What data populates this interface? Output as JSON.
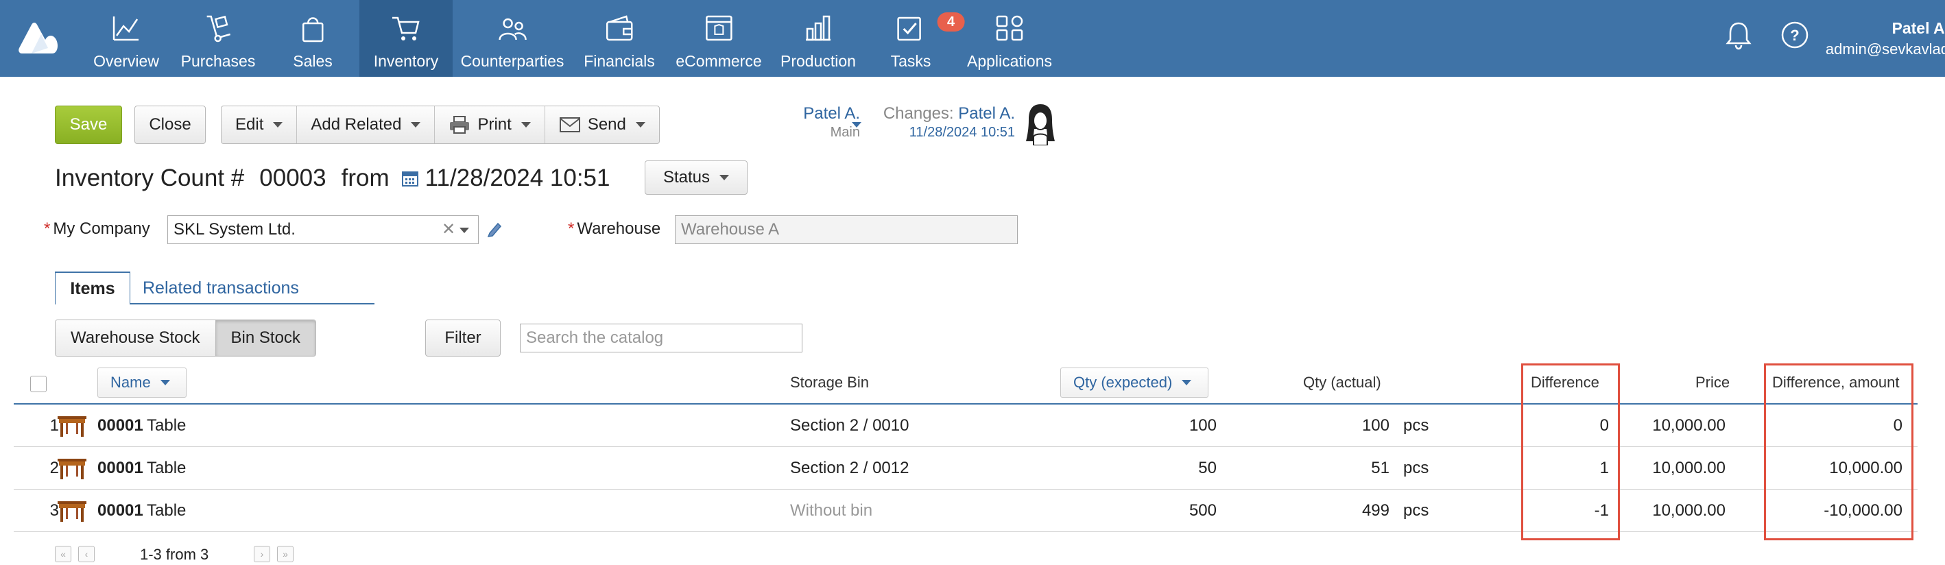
{
  "nav": {
    "items": [
      {
        "label": "Overview",
        "icon": "chart-line-icon",
        "active": false
      },
      {
        "label": "Purchases",
        "icon": "hand-truck-icon",
        "active": false
      },
      {
        "label": "Sales",
        "icon": "shopping-bag-icon",
        "active": false
      },
      {
        "label": "Inventory",
        "icon": "cart-icon",
        "active": true
      },
      {
        "label": "Counterparties",
        "icon": "people-icon",
        "active": false
      },
      {
        "label": "Financials",
        "icon": "wallet-icon",
        "active": false
      },
      {
        "label": "eCommerce",
        "icon": "store-icon",
        "active": false
      },
      {
        "label": "Production",
        "icon": "factory-icon",
        "active": false
      },
      {
        "label": "Tasks",
        "icon": "checkbox-icon",
        "active": false,
        "badge": "4"
      },
      {
        "label": "Applications",
        "icon": "apps-grid-icon",
        "active": false
      }
    ],
    "user_name": "Patel A.",
    "user_email": "admin@sevkavlad"
  },
  "toolbar": {
    "save": "Save",
    "close": "Close",
    "edit": "Edit",
    "add_related": "Add Related",
    "print": "Print",
    "send": "Send"
  },
  "responsible": {
    "name": "Patel A.",
    "sub": "Main"
  },
  "changes": {
    "label": "Changes:",
    "name": "Patel A.",
    "date": "11/28/2024 10:51"
  },
  "document": {
    "title": "Inventory Count #",
    "number": "00003",
    "from": "from",
    "datetime": "11/28/2024 10:51",
    "status": "Status"
  },
  "fields": {
    "company_label": "My Company",
    "company_value": "SKL System Ltd.",
    "warehouse_label": "Warehouse",
    "warehouse_placeholder": "Warehouse A"
  },
  "tabs": {
    "items": "Items",
    "related": "Related transactions"
  },
  "stock_toggle": {
    "warehouse": "Warehouse Stock",
    "bin": "Bin Stock"
  },
  "filter": {
    "button": "Filter",
    "placeholder": "Search the catalog"
  },
  "table": {
    "headers": {
      "name": "Name",
      "storage_bin": "Storage Bin",
      "qty_expected": "Qty (expected)",
      "qty_actual": "Qty (actual)",
      "difference": "Difference",
      "price": "Price",
      "difference_amount": "Difference, amount"
    },
    "rows": [
      {
        "num": "1",
        "code": "00001",
        "name": "Table",
        "bin": "Section 2 / 0010",
        "bin_muted": false,
        "expected": "100",
        "actual": "100",
        "unit": "pcs",
        "difference": "0",
        "price": "10,000.00",
        "diff_amount": "0"
      },
      {
        "num": "2",
        "code": "00001",
        "name": "Table",
        "bin": "Section 2 / 0012",
        "bin_muted": false,
        "expected": "50",
        "actual": "51",
        "unit": "pcs",
        "difference": "1",
        "price": "10,000.00",
        "diff_amount": "10,000.00"
      },
      {
        "num": "3",
        "code": "00001",
        "name": "Table",
        "bin": "Without bin",
        "bin_muted": true,
        "expected": "500",
        "actual": "499",
        "unit": "pcs",
        "difference": "-1",
        "price": "10,000.00",
        "diff_amount": "-10,000.00"
      }
    ]
  },
  "pager": {
    "text": "1-3 from 3"
  },
  "colors": {
    "topbar": "#3f73a7",
    "topbar_active": "#2f5f8f",
    "save_green": "#8db526",
    "link_blue": "#2f65a0",
    "highlight_red": "#e0503f",
    "badge_red": "#e8604c"
  }
}
